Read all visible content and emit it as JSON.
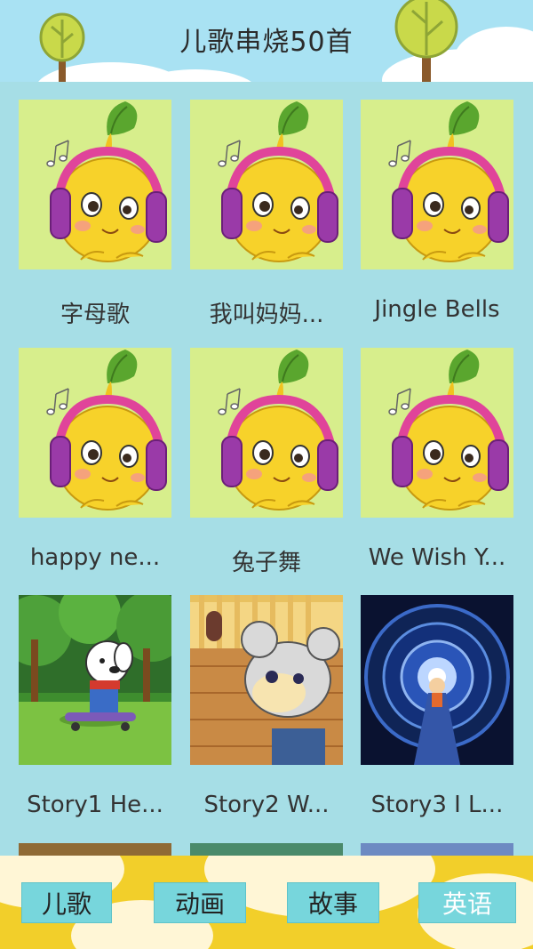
{
  "header": {
    "title": "儿歌串烧50首"
  },
  "items": [
    {
      "caption": "字母歌",
      "thumb": "singer"
    },
    {
      "caption": "我叫妈妈...",
      "thumb": "singer"
    },
    {
      "caption": "Jingle Bells",
      "thumb": "singer"
    },
    {
      "caption": "happy ne...",
      "thumb": "singer"
    },
    {
      "caption": "兔子舞",
      "thumb": "singer"
    },
    {
      "caption": "We Wish Y...",
      "thumb": "singer"
    },
    {
      "caption": "Story1  He...",
      "thumb": "dog-skateboard"
    },
    {
      "caption": "Story2  W...",
      "thumb": "mouse-room"
    },
    {
      "caption": "Story3  I L...",
      "thumb": "tunnel"
    }
  ],
  "tabs": [
    {
      "label": "儿歌",
      "active": false
    },
    {
      "label": "动画",
      "active": false
    },
    {
      "label": "故事",
      "active": false
    },
    {
      "label": "英语",
      "active": true
    }
  ],
  "colors": {
    "background": "#a6dee6",
    "footer": "#f2cf2a",
    "tab": "#77d6dc"
  }
}
